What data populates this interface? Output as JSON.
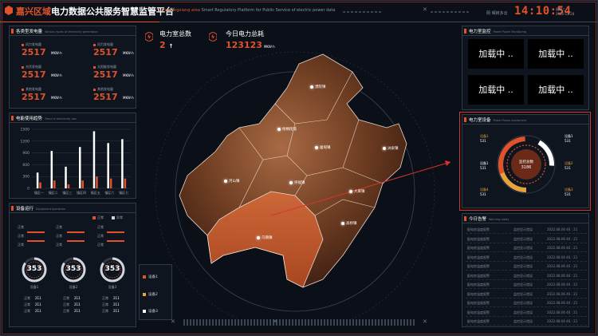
{
  "header": {
    "title_region": "嘉兴区域",
    "title_main": "电力数据公共服务智慧监管平台",
    "subtitle_region": "The Tongxiang area",
    "subtitle_main": "Smart Regulatory Platform for Public Service of electric power data",
    "weather": "阴 晴转多云",
    "clock": "14:10:54",
    "date_line1": "星期三",
    "date_line2": "2022-11-28"
  },
  "colors": {
    "accent": "#e0522b",
    "accent_orange": "#e6a23c",
    "highlight_box": "#d8352a",
    "ring_grey": "#cfd6e0"
  },
  "generation": {
    "title": "各类型发电量",
    "subtitle": "Various types of electricity generation",
    "items": [
      {
        "label": "风力发电量",
        "value": "2517",
        "unit": "MKW·h"
      },
      {
        "label": "风力发电量",
        "value": "2517",
        "unit": "MKW·h"
      },
      {
        "label": "光伏发电量",
        "value": "2517",
        "unit": "MKW·h"
      },
      {
        "label": "太阳能发电量",
        "value": "2517",
        "unit": "MKW·h"
      },
      {
        "label": "其他发电量",
        "value": "2517",
        "unit": "MKW·h"
      },
      {
        "label": "其他发电量",
        "value": "2517",
        "unit": "MKW·h"
      }
    ]
  },
  "usage": {
    "title": "电能使用趋势",
    "subtitle": "Trend in electricity use"
  },
  "chart_data": {
    "type": "bar",
    "categories": [
      "镇区一",
      "镇区二",
      "镇区三",
      "镇区四",
      "镇区五",
      "镇区六",
      "镇区七"
    ],
    "series": [
      {
        "values": [
          400,
          950,
          550,
          1050,
          1450,
          1150,
          1250
        ]
      },
      {
        "values": [
          150,
          200,
          100,
          200,
          300,
          250,
          250
        ]
      }
    ],
    "yticks": [
      "1500",
      "1200",
      "900",
      "600",
      "300",
      "0"
    ],
    "ylim": [
      0,
      1500
    ],
    "grid": true
  },
  "equipment": {
    "title": "设备运行",
    "subtitle": "Equipment operation",
    "legend": [
      "正常",
      "异常"
    ],
    "rows": [
      {
        "label": "正常"
      },
      {
        "label": "正常"
      },
      {
        "label": "正常"
      },
      {
        "label": "正常"
      },
      {
        "label": "正常"
      },
      {
        "label": "正常"
      },
      {
        "label": "正常"
      },
      {
        "label": "正常"
      },
      {
        "label": "正常"
      }
    ],
    "rings": [
      {
        "value": "353",
        "caption": "设备1",
        "pct": 0.85
      },
      {
        "value": "353",
        "caption": "设备2",
        "pct": 0.85
      },
      {
        "value": "353",
        "caption": "设备3",
        "pct": 0.85
      }
    ],
    "kv": [
      {
        "k": "正常",
        "v": "211"
      },
      {
        "k": "正常",
        "v": "211"
      },
      {
        "k": "正常",
        "v": "211"
      },
      {
        "k": "正常",
        "v": "211"
      },
      {
        "k": "正常",
        "v": "211"
      },
      {
        "k": "正常",
        "v": "211"
      },
      {
        "k": "正常",
        "v": "211"
      },
      {
        "k": "正常",
        "v": "211"
      },
      {
        "k": "正常",
        "v": "211"
      }
    ]
  },
  "stats": {
    "room_label": "电力室总数",
    "room_value": "2",
    "room_arrow": "↑",
    "power_label": "今日电力总耗",
    "power_value": "123123",
    "power_unit": "MKW·h"
  },
  "map": {
    "places": [
      {
        "name": "濮院镇"
      },
      {
        "name": "梧桐街道"
      },
      {
        "name": "屠甸镇"
      },
      {
        "name": "洲泉镇"
      },
      {
        "name": "河山镇"
      },
      {
        "name": "崇福镇"
      },
      {
        "name": "大麻镇"
      },
      {
        "name": "高桥镇"
      },
      {
        "name": "乌镇镇"
      }
    ],
    "legend": [
      "设备1",
      "设备2",
      "设备3"
    ]
  },
  "monitor": {
    "title": "电力室监控",
    "subtitle": "Power Room Monitoring",
    "loading": [
      "加载中 ..",
      "加载中 ..",
      "加载中 ..",
      "加载中 .."
    ]
  },
  "room_equipment": {
    "title": "电力室设备",
    "subtitle": "Power Room equipment",
    "center_label": "监控总数",
    "center_value": "3186",
    "items": [
      {
        "label": "设备1",
        "value": "531"
      },
      {
        "label": "设备1",
        "value": "531"
      },
      {
        "label": "设备1",
        "value": "531"
      },
      {
        "label": "设备2",
        "value": "531"
      },
      {
        "label": "设备4",
        "value": "531"
      },
      {
        "label": "设备3",
        "value": "531"
      }
    ]
  },
  "warnings": {
    "title": "今日告警",
    "subtitle": "Warning today",
    "rows": [
      {
        "name": "配电房温度报警",
        "status": "监控显示错误",
        "time": "2022.08.06  46 : 21"
      },
      {
        "name": "配电房温度报警",
        "status": "监控显示错误",
        "time": "2022.08.06  46 : 21"
      },
      {
        "name": "配电房温度报警",
        "status": "监控显示错误",
        "time": "2022.08.06  46 : 21"
      },
      {
        "name": "配电房温度报警",
        "status": "监控显示错误",
        "time": "2022.08.06  46 : 21"
      },
      {
        "name": "配电房温度报警",
        "status": "监控显示错误",
        "time": "2022.08.06  46 : 21"
      },
      {
        "name": "配电房温度报警",
        "status": "监控显示错误",
        "time": "2022.08.06  46 : 21"
      },
      {
        "name": "配电房温度报警",
        "status": "监控显示错误",
        "time": "2022.08.06  46 : 21"
      },
      {
        "name": "配电房温度报警",
        "status": "监控显示错误",
        "time": "2022.08.06  46 : 21"
      },
      {
        "name": "配电房温度报警",
        "status": "监控显示错误",
        "time": "2022.08.06  46 : 21"
      },
      {
        "name": "配电房温度报警",
        "status": "监控显示错误",
        "time": "2022.08.06  46 : 21"
      },
      {
        "name": "配电房温度报警",
        "status": "监控显示错误",
        "time": "2022.08.06  46 : 21"
      }
    ]
  }
}
